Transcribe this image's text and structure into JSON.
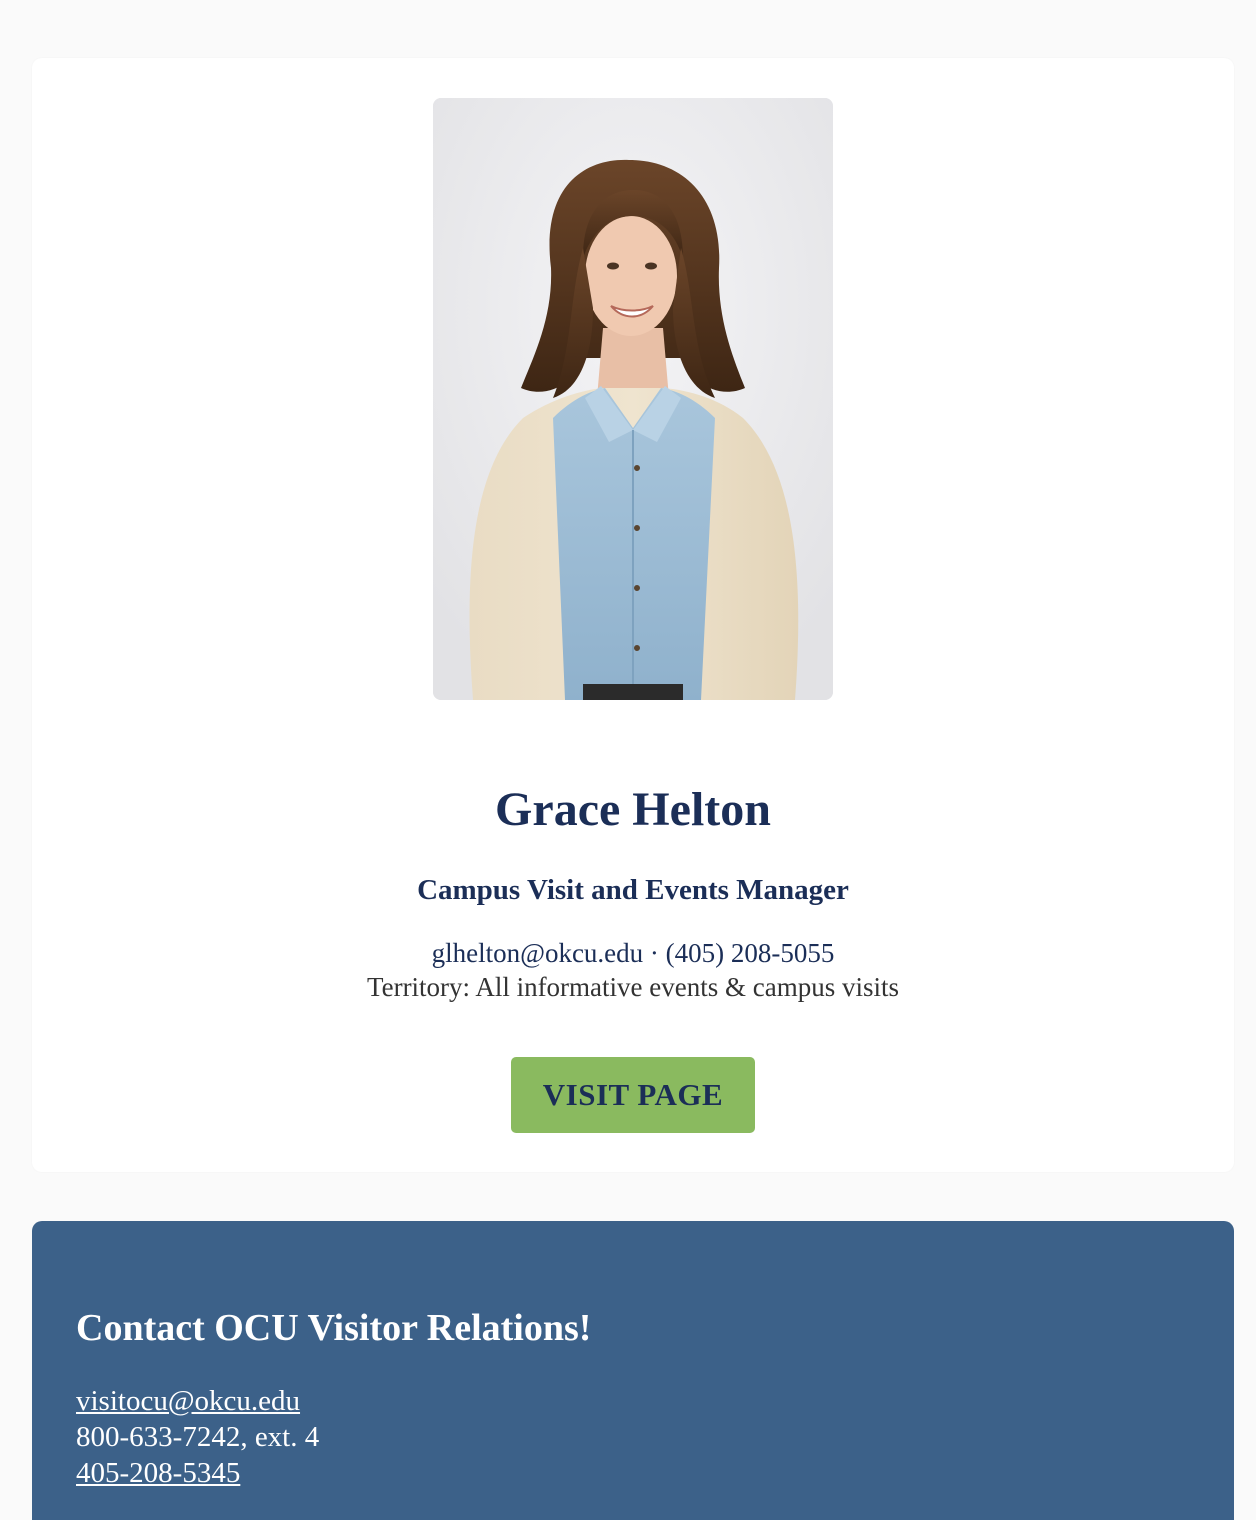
{
  "profile": {
    "photo_alt": "Grace Helton",
    "name": "Grace Helton",
    "title": "Campus Visit and Events Manager",
    "email": "glhelton@okcu.edu",
    "separator": "·",
    "phone": "(405) 208-5055",
    "territory": "Territory: All informative events & campus visits",
    "button_label": "VISIT PAGE"
  },
  "contact": {
    "heading": "Contact OCU Visitor Relations!",
    "email": "visitocu@okcu.edu",
    "phone_main": "800-633-7242, ext. 4",
    "phone_alt": "405-208-5345"
  },
  "colors": {
    "brand_navy": "#1b2e57",
    "button_green": "#8aba5f",
    "panel_blue": "#3c6189"
  }
}
